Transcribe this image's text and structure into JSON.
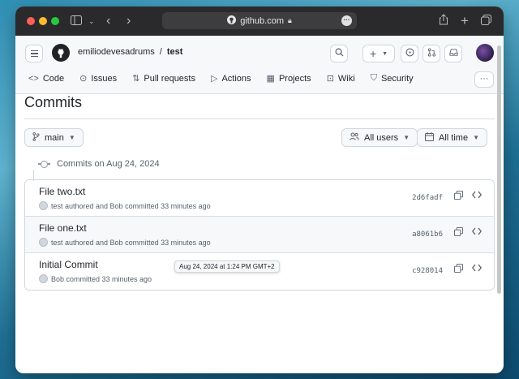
{
  "browser": {
    "url": "github.com",
    "colors": {
      "close": "#ff5f57",
      "minimize": "#febc2e",
      "maximize": "#28c840"
    }
  },
  "header": {
    "owner": "emiliodevesadrums",
    "separator": "/",
    "repo": "test",
    "icons": [
      "hamburger-icon",
      "github-logo",
      "search-icon",
      "plus-icon",
      "issue-icon",
      "pull-request-icon",
      "inbox-icon"
    ]
  },
  "tabs": [
    {
      "label": "Code",
      "icon": "code-icon",
      "glyph": "<>"
    },
    {
      "label": "Issues",
      "icon": "issue-icon",
      "glyph": "⊙"
    },
    {
      "label": "Pull requests",
      "icon": "pull-request-icon",
      "glyph": "⇅"
    },
    {
      "label": "Actions",
      "icon": "play-icon",
      "glyph": "▷"
    },
    {
      "label": "Projects",
      "icon": "table-icon",
      "glyph": "▦"
    },
    {
      "label": "Wiki",
      "icon": "book-icon",
      "glyph": "⊡"
    },
    {
      "label": "Security",
      "icon": "shield-icon",
      "glyph": "⛉"
    }
  ],
  "main": {
    "title": "Commits",
    "branch": "main",
    "users_filter": "All users",
    "time_filter": "All time",
    "group_label": "Commits on Aug 24, 2024",
    "commits": [
      {
        "title": "File two.txt",
        "meta": "test authored and Bob committed 33 minutes ago",
        "sha": "2d6fadf"
      },
      {
        "title": "File one.txt",
        "meta": "test authored and Bob committed 33 minutes ago",
        "sha": "a8061b6"
      },
      {
        "title": "Initial Commit",
        "meta": "Bob committed 33 minutes ago",
        "sha": "c928014"
      }
    ],
    "tooltip": "Aug 24, 2024 at 1:24 PM GMT+2"
  }
}
